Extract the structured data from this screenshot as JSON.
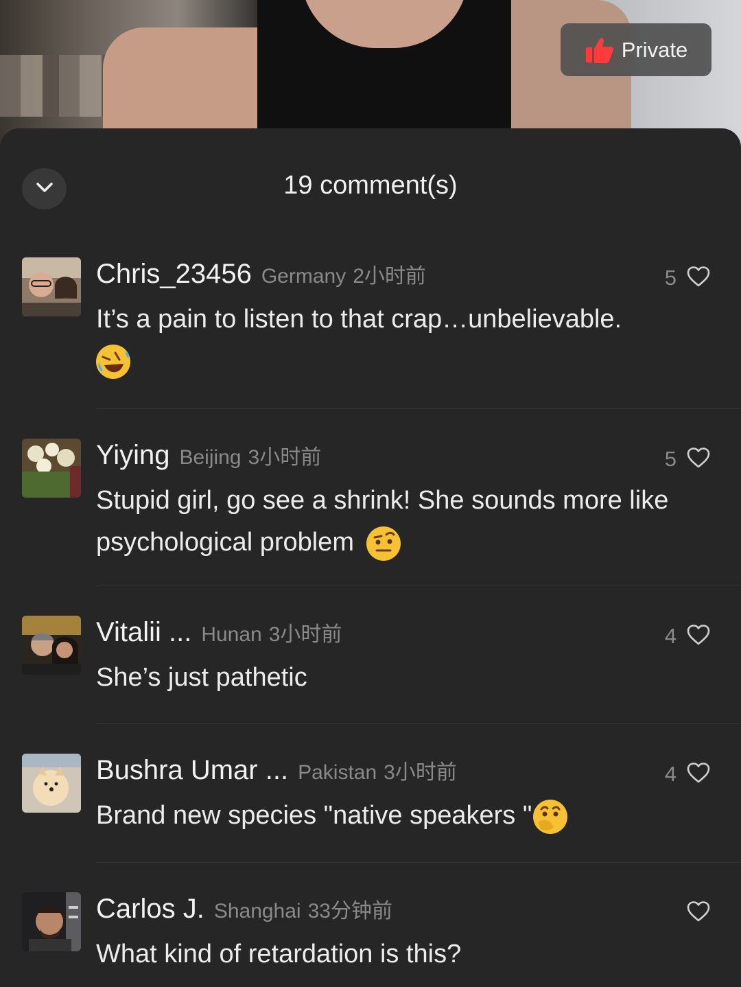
{
  "video": {
    "private_label": "Private",
    "thumb_icon": "thumbs-up-icon",
    "accent": "#ff3b3b"
  },
  "sheet": {
    "title": "19 comment(s)",
    "collapse_icon": "chevron-down-icon"
  },
  "comments": [
    {
      "username": "Chris_23456",
      "location": "Germany",
      "time": "2小时前",
      "likes": "5",
      "text": "It’s a pain to listen to that crap…unbelievable.",
      "emoji": "rolling-laughing-emoji"
    },
    {
      "username": "Yiying",
      "location": "Beijing",
      "time": "3小时前",
      "likes": "5",
      "text": "Stupid girl, go see a shrink! She sounds more like psychological problem",
      "emoji": "raised-eyebrow-emoji"
    },
    {
      "username": "Vitalii ...",
      "location": "Hunan",
      "time": "3小时前",
      "likes": "4",
      "text": "She’s just pathetic",
      "emoji": ""
    },
    {
      "username": "Bushra Umar ...",
      "location": "Pakistan",
      "time": "3小时前",
      "likes": "4",
      "text": "Brand new species \"native speakers \"",
      "emoji": "thinking-face-emoji"
    },
    {
      "username": "Carlos J.",
      "location": "Shanghai",
      "time": "33分钟前",
      "likes": "",
      "text": "What kind of retardation is this?",
      "emoji": ""
    }
  ]
}
